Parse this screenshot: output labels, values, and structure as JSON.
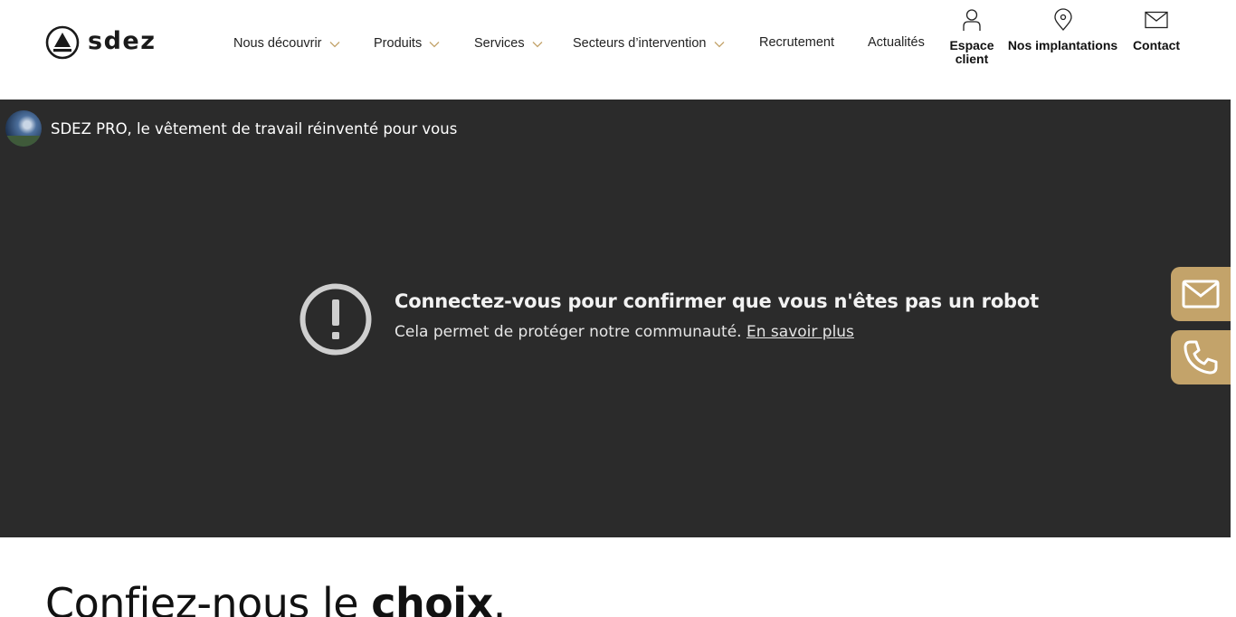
{
  "brand": {
    "name": "sdez"
  },
  "nav": {
    "items": [
      {
        "label": "Nous découvrir",
        "has_dropdown": true
      },
      {
        "label": "Produits",
        "has_dropdown": true
      },
      {
        "label": "Services",
        "has_dropdown": true
      },
      {
        "label": "Secteurs d’intervention",
        "has_dropdown": true
      },
      {
        "label": "Recrutement",
        "has_dropdown": false
      },
      {
        "label": "Actualités",
        "has_dropdown": false
      }
    ]
  },
  "utility": {
    "espace_client": {
      "label_line1": "Espace",
      "label_line2": "client",
      "icon": "user-icon"
    },
    "implantations": {
      "label": "Nos implantations",
      "icon": "map-pin-icon"
    },
    "contact": {
      "label": "Contact",
      "icon": "mail-icon"
    }
  },
  "video": {
    "title": "SDEZ PRO, le vêtement de travail réinventé pour vous",
    "error_heading": "Connectez-vous pour confirmer que vous n'êtes pas un robot",
    "error_text": "Cela permet de protéger notre communauté.",
    "error_link": "En savoir plus"
  },
  "side_buttons": [
    {
      "icon": "mail-icon"
    },
    {
      "icon": "phone-icon"
    }
  ],
  "section": {
    "heading_light": "Confiez-nous le ",
    "heading_bold": "choix",
    "heading_end": "."
  },
  "colors": {
    "accent": "#c3a36a",
    "embed_bg": "#2b2b2b",
    "chevron": "#c3a36a"
  }
}
